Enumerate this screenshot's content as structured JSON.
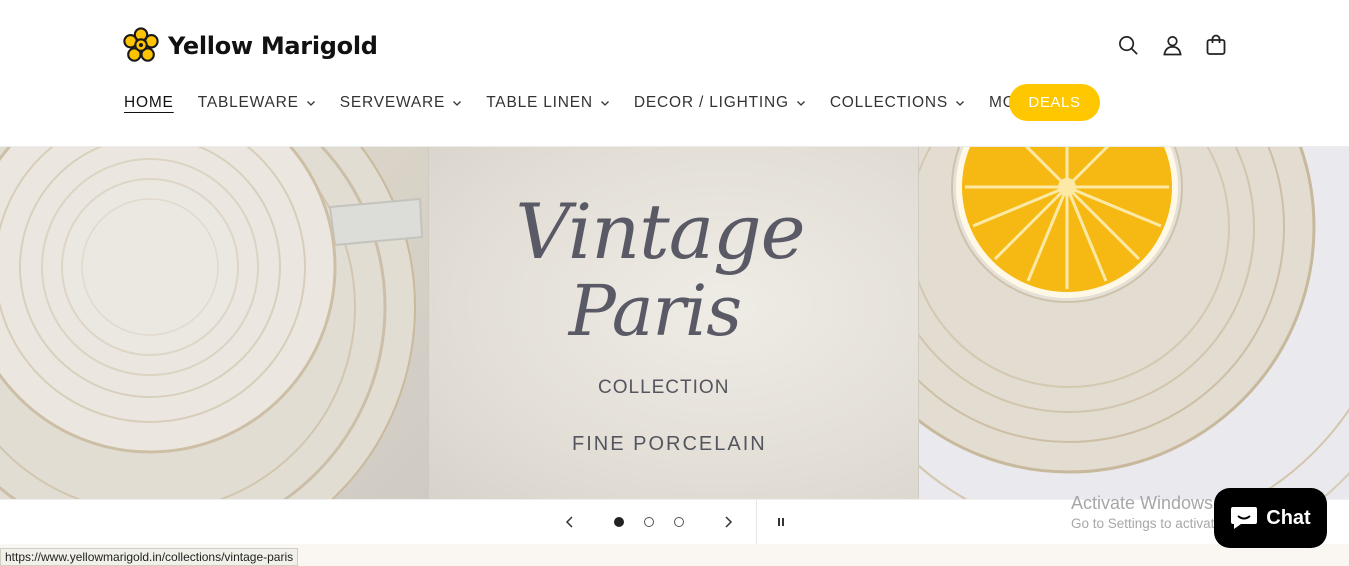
{
  "brand": {
    "name": "Yellow Marigold",
    "accent": "#ffc700"
  },
  "header_icons": [
    {
      "name": "search-icon"
    },
    {
      "name": "account-icon"
    },
    {
      "name": "cart-icon"
    }
  ],
  "nav": {
    "items": [
      {
        "label": "HOME",
        "active": true,
        "dropdown": false
      },
      {
        "label": "TABLEWARE",
        "dropdown": true
      },
      {
        "label": "SERVEWARE",
        "dropdown": true
      },
      {
        "label": "TABLE LINEN",
        "dropdown": true
      },
      {
        "label": "DECOR / LIGHTING",
        "dropdown": true
      },
      {
        "label": "COLLECTIONS",
        "dropdown": true
      },
      {
        "label": "MORE",
        "dropdown": true
      }
    ],
    "deals_label": "DEALS"
  },
  "hero": {
    "title_line1": "Vintage",
    "title_line2": "Paris",
    "subtitle": "COLLECTION",
    "tagline": "FINE PORCELAIN"
  },
  "slider": {
    "slide_count": 3,
    "active_slide": 1,
    "prev_icon": "chevron-left-icon",
    "next_icon": "chevron-right-icon",
    "pause_icon": "pause-icon"
  },
  "status_bar": {
    "url": "https://www.yellowmarigold.in/collections/vintage-paris"
  },
  "watermark": {
    "line1": "Activate Windows",
    "line2": "Go to Settings to activate Windows."
  },
  "chat": {
    "label": "Chat"
  }
}
